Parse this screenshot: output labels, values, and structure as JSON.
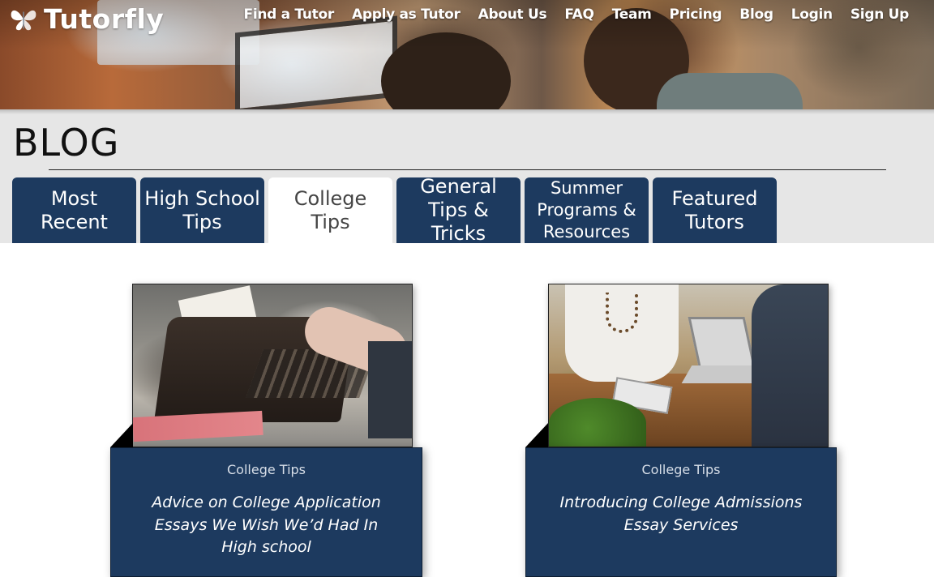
{
  "brand": {
    "name": "Tutorfly",
    "logo_icon": "butterfly-icon"
  },
  "nav": [
    {
      "label": "Find a Tutor"
    },
    {
      "label": "Apply as Tutor"
    },
    {
      "label": "About Us"
    },
    {
      "label": "FAQ"
    },
    {
      "label": "Team"
    },
    {
      "label": "Pricing"
    },
    {
      "label": "Blog"
    },
    {
      "label": "Login"
    },
    {
      "label": "Sign Up"
    }
  ],
  "page": {
    "title": "BLOG"
  },
  "tabs": [
    {
      "label": "Most Recent",
      "active": false
    },
    {
      "label": "High School Tips",
      "active": false
    },
    {
      "label": "College Tips",
      "active": true
    },
    {
      "label": "General Tips & Tricks",
      "active": false
    },
    {
      "label": "Summer Programs & Resources",
      "active": false
    },
    {
      "label": "Featured Tutors",
      "active": false
    }
  ],
  "posts": [
    {
      "category": "College Tips",
      "title": "Advice on College Application Essays We Wish We’d Had In High school",
      "image": "typewriter-photo"
    },
    {
      "category": "College Tips",
      "title": "Introducing College Admissions Essay Services",
      "image": "meeting-laptop-photo"
    }
  ],
  "colors": {
    "navy": "#1d3a5f",
    "band": "#e6e6e6",
    "active_tab": "#ffffff"
  }
}
